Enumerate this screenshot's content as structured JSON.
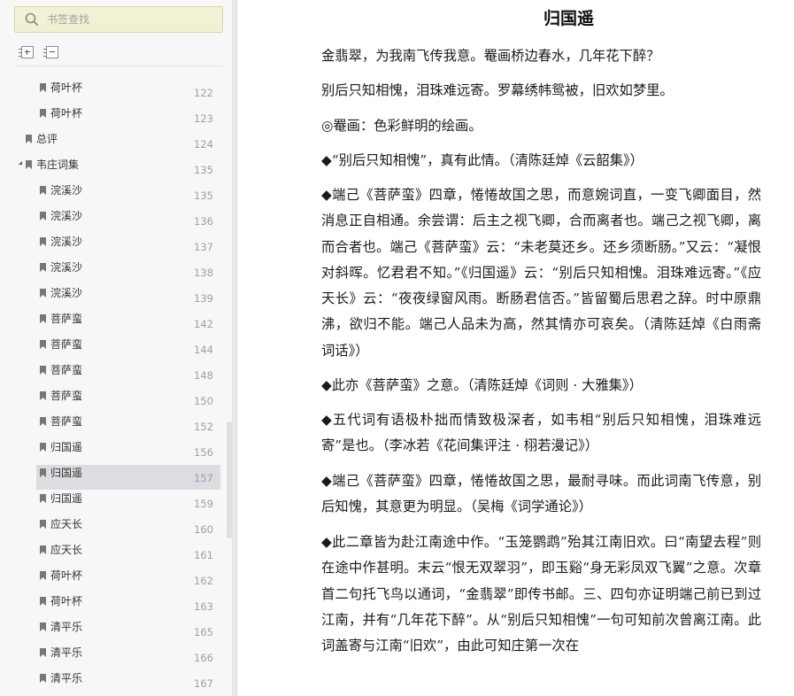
{
  "sidebar": {
    "search": {
      "placeholder": "书签查找"
    },
    "toolbar": {
      "expand_all_label": "",
      "collapse_all_label": ""
    },
    "items": [
      {
        "label": "荷叶杯",
        "page": "122",
        "level": 2
      },
      {
        "label": "荷叶杯",
        "page": "123",
        "level": 2
      },
      {
        "label": "总评",
        "page": "124",
        "level": 1
      },
      {
        "label": "韦庄词集",
        "page": "135",
        "level": 1,
        "expanded": true
      },
      {
        "label": "浣溪沙",
        "page": "135",
        "level": 2
      },
      {
        "label": "浣溪沙",
        "page": "136",
        "level": 2
      },
      {
        "label": "浣溪沙",
        "page": "137",
        "level": 2
      },
      {
        "label": "浣溪沙",
        "page": "138",
        "level": 2
      },
      {
        "label": "浣溪沙",
        "page": "139",
        "level": 2
      },
      {
        "label": "菩萨蛮",
        "page": "142",
        "level": 2
      },
      {
        "label": "菩萨蛮",
        "page": "144",
        "level": 2
      },
      {
        "label": "菩萨蛮",
        "page": "148",
        "level": 2
      },
      {
        "label": "菩萨蛮",
        "page": "150",
        "level": 2
      },
      {
        "label": "菩萨蛮",
        "page": "152",
        "level": 2
      },
      {
        "label": "归国遥",
        "page": "156",
        "level": 2
      },
      {
        "label": "归国遥",
        "page": "157",
        "level": 2,
        "selected": true
      },
      {
        "label": "归国遥",
        "page": "159",
        "level": 2
      },
      {
        "label": "应天长",
        "page": "160",
        "level": 2
      },
      {
        "label": "应天长",
        "page": "161",
        "level": 2
      },
      {
        "label": "荷叶杯",
        "page": "162",
        "level": 2
      },
      {
        "label": "荷叶杯",
        "page": "163",
        "level": 2
      },
      {
        "label": "清平乐",
        "page": "165",
        "level": 2
      },
      {
        "label": "清平乐",
        "page": "166",
        "level": 2
      },
      {
        "label": "清平乐",
        "page": "167",
        "level": 2
      }
    ]
  },
  "document": {
    "title": "归国遥",
    "paragraphs": [
      "金翡翠，为我南飞传我意。罨画桥边春水，几年花下醉？",
      "别后只知相愧，泪珠难远寄。罗幕绣帏鸳被，旧欢如梦里。",
      "◎罨画：色彩鲜明的绘画。",
      "◆“别后只知相愧”，真有此情。（清陈廷焯《云韶集》）",
      "◆端己《菩萨蛮》四章，惓惓故国之思，而意婉词直，一变飞卿面目，然消息正自相通。余尝谓：后主之视飞卿，合而离者也。端己之视飞卿，离而合者也。端己《菩萨蛮》云：“未老莫还乡。还乡须断肠。”又云：“凝恨对斜晖。忆君君不知。”《归国遥》云：“别后只知相愧。泪珠难远寄。”《应天长》云：“夜夜绿窗风雨。断肠君信否。”皆留蜀后思君之辞。时中原鼎沸，欲归不能。端己人品未为高，然其情亦可哀矣。（清陈廷焯《白雨斋词话》）",
      "◆此亦《菩萨蛮》之意。（清陈廷焯《词则 · 大雅集》）",
      "◆五代词有语极朴拙而情致极深者，如韦相“别后只知相愧，泪珠难远寄”是也。（李冰若《花间集评注 · 栩若漫记》）",
      "◆端己《菩萨蛮》四章，惓惓故国之思，最耐寻味。而此词南飞传意，别后知愧，其意更为明显。（吴梅《词学通论》）",
      "◆此二章皆为赴江南途中作。“玉笼鹦鹉”殆其江南旧欢。曰“南望去程”则在途中作甚明。末云“恨无双翠羽”，即玉谿“身无彩凤双飞翼”之意。次章首二句托飞鸟以通词，“金翡翠”即传书邮。三、四句亦证明端己前已到过江南，并有“几年花下醉”。从“别后只知相愧”一句可知前次曾离江南。此词盖寄与江南“旧欢”，由此可知庄第一次在"
    ]
  }
}
